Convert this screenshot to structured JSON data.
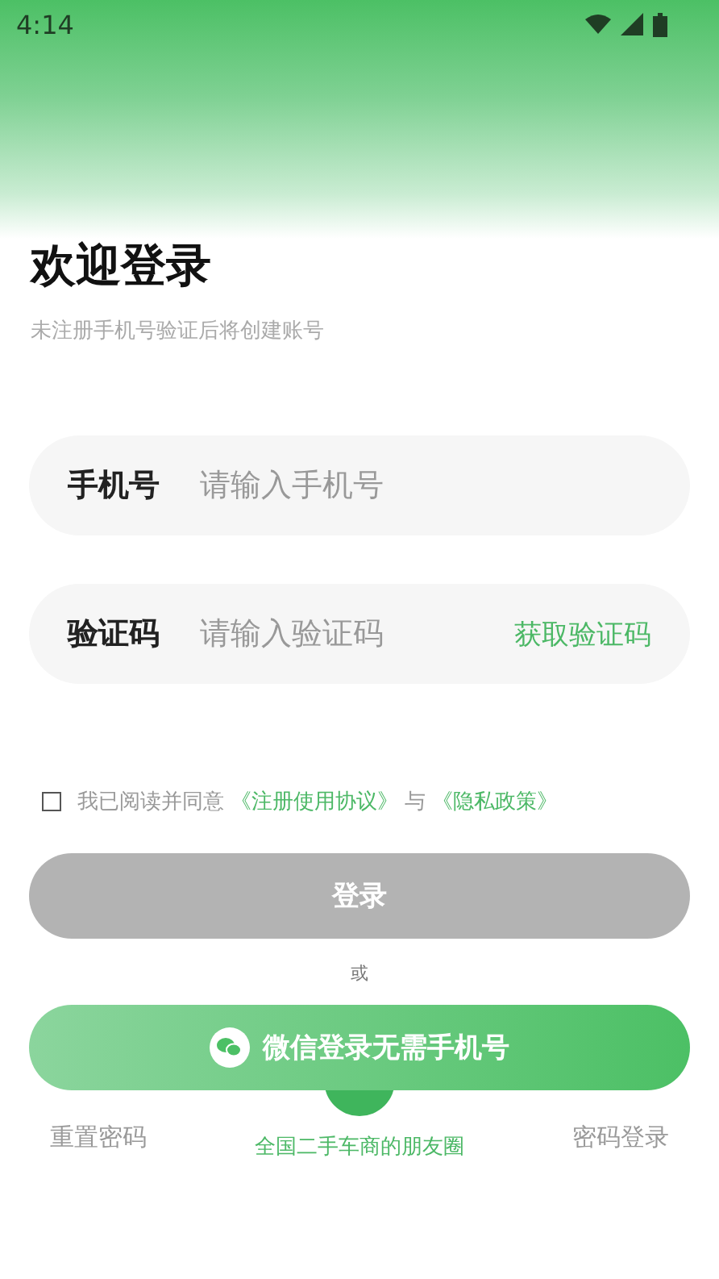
{
  "status_bar": {
    "time": "4:14"
  },
  "header": {
    "title": "欢迎登录",
    "subtitle": "未注册手机号验证后将创建账号"
  },
  "fields": [
    {
      "kind": "phone",
      "label": "手机号",
      "placeholder": "请输入手机号"
    },
    {
      "kind": "code",
      "label": "验证码",
      "placeholder": "请输入验证码",
      "action": "获取验证码"
    }
  ],
  "agreement": {
    "checked": false,
    "text": "我已阅读并同意",
    "link_1": "《注册使用协议》",
    "joiner": "与",
    "link_2": "《隐私政策》"
  },
  "login_button": {
    "label": "登录",
    "disabled": true
  },
  "divider_text": "或",
  "wechat_button": {
    "label": "微信登录无需手机号"
  },
  "footer": {
    "left": "重置密码",
    "slogan": "全国二手车商的朋友圈",
    "right": "密码登录"
  }
}
